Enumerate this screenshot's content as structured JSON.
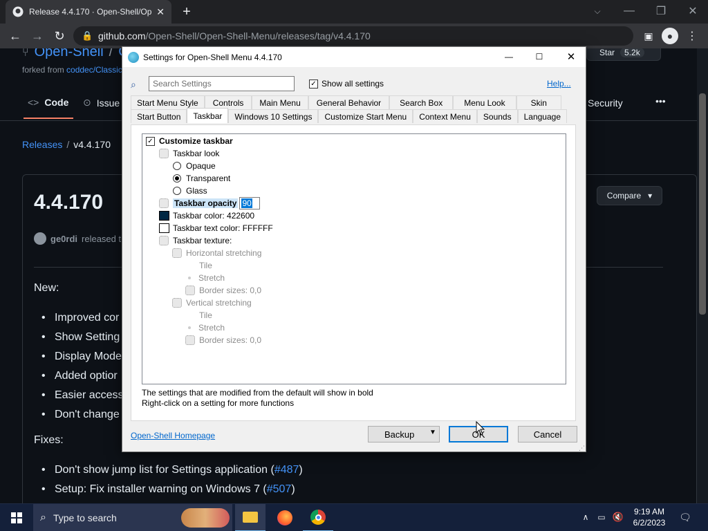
{
  "browser": {
    "tab_title": "Release 4.4.170 · Open-Shell/Op",
    "url_host": "github.com",
    "url_path": "/Open-Shell/Open-Shell-Menu/releases/tag/v4.4.170"
  },
  "github": {
    "repo_owner": "Open-Shell",
    "repo_sep": "/",
    "repo_name_partial": "C",
    "forked_from_label": "forked from",
    "forked_from_link": "coddec/Classic",
    "star_label": "Star",
    "star_count": "5.2k",
    "nav": {
      "code": "Code",
      "issues": "Issue",
      "security": "Security",
      "more": "•••"
    },
    "breadcrumb_releases": "Releases",
    "breadcrumb_sep": "/",
    "breadcrumb_version": "v4.4.170",
    "release_title": "4.4.170",
    "compare_label": "Compare",
    "author": "ge0rdi",
    "released_text": "released t",
    "new_heading": "New:",
    "new_items": [
      "Improved cor",
      "Show Setting",
      "Display Mode",
      "Added optior",
      "Easier access",
      "Don't change"
    ],
    "fixes_heading": "Fixes:",
    "fix_items": [
      {
        "text": "Don't show jump list for Settings application (",
        "link": "#487",
        "end": ")"
      },
      {
        "text": "Setup: Fix installer warning on Windows 7 (",
        "link": "#507",
        "end": ")"
      }
    ]
  },
  "dialog": {
    "title": "Settings for Open-Shell Menu 4.4.170",
    "search_placeholder": "Search Settings",
    "show_all_label": "Show all settings",
    "help_link": "Help...",
    "tabs_row1": [
      "Start Menu Style",
      "Controls",
      "Main Menu",
      "General Behavior",
      "Search Box",
      "Menu Look",
      "Skin"
    ],
    "tabs_row2": [
      "Start Button",
      "Taskbar",
      "Windows 10 Settings",
      "Customize Start Menu",
      "Context Menu",
      "Sounds",
      "Language"
    ],
    "active_tab": "Taskbar",
    "tree": {
      "customize_taskbar": "Customize taskbar",
      "taskbar_look": "Taskbar look",
      "opaque": "Opaque",
      "transparent": "Transparent",
      "glass": "Glass",
      "taskbar_opacity": "Taskbar opacity",
      "opacity_value": "90",
      "taskbar_color": "Taskbar color: 422600",
      "taskbar_color_swatch": "#002642",
      "taskbar_text_color": "Taskbar text color: FFFFFF",
      "taskbar_text_swatch": "#ffffff",
      "taskbar_texture": "Taskbar texture:",
      "horizontal_stretching": "Horizontal stretching",
      "tile_h": "Tile",
      "stretch_h": "Stretch",
      "border_h": "Border sizes: 0,0",
      "vertical_stretching": "Vertical stretching",
      "tile_v": "Tile",
      "stretch_v": "Stretch",
      "border_v": "Border sizes: 0,0"
    },
    "hint1": "The settings that are modified from the default will show in bold",
    "hint2": "Right-click on a setting for more functions",
    "homepage_link": "Open-Shell Homepage",
    "backup_label": "Backup",
    "ok_label": "OK",
    "cancel_label": "Cancel"
  },
  "taskbar": {
    "search_placeholder": "Type to search",
    "time": "9:19 AM",
    "date": "6/2/2023"
  }
}
